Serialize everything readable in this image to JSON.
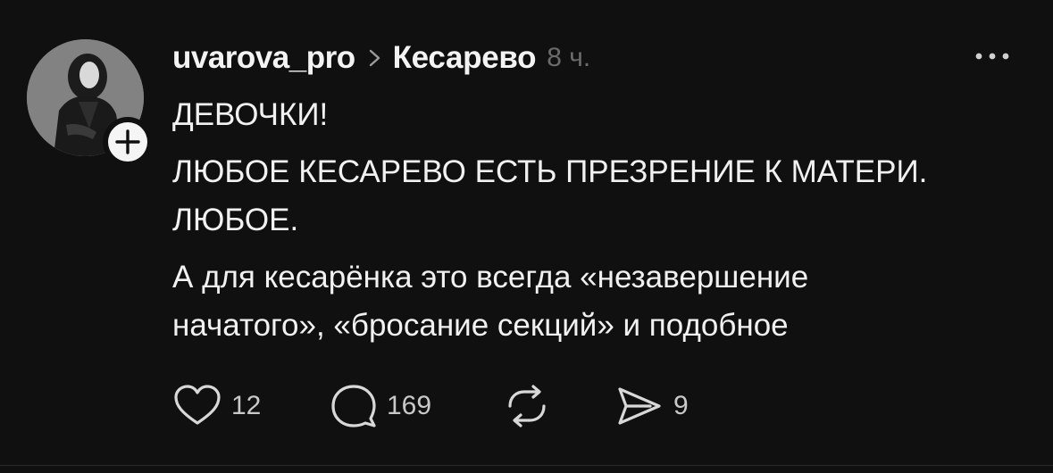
{
  "post": {
    "username": "uvarova_pro",
    "topic": "Кесарево",
    "time": "8 ч.",
    "paragraphs": {
      "p1": "ДЕВОЧКИ!",
      "p2_line1": "ЛЮБОЕ КЕСАРЕВО ЕСТЬ ПРЕЗРЕНИЕ К МАТЕРИ.",
      "p2_line2": "ЛЮБОЕ.",
      "p3_line1": "А для кесарёнка это всегда «незавершение",
      "p3_line2": "начатого», «бросание секций» и подобное"
    },
    "actions": {
      "likes": "12",
      "comments": "169",
      "shares": "9"
    }
  },
  "icons": {
    "avatar": "avatar-photo",
    "follow": "plus-icon",
    "chevron": "chevron-right-icon",
    "more": "more-dots-icon",
    "like": "heart-icon",
    "comment": "comment-bubble-icon",
    "repost": "repost-arrows-icon",
    "share": "send-icon"
  },
  "colors": {
    "background": "#101010",
    "text": "#f3f3f3",
    "muted": "#6b6b6b"
  }
}
